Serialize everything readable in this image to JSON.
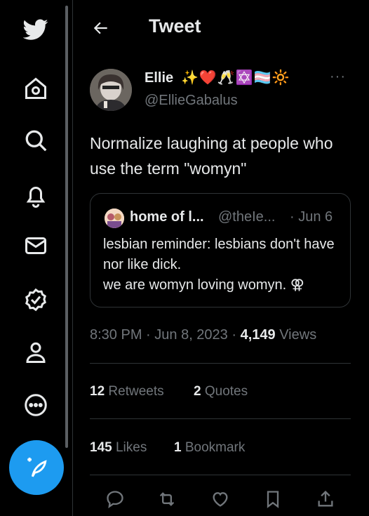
{
  "header": {
    "title": "Tweet"
  },
  "tweet": {
    "author_name": "Ellie",
    "author_emojis": "✨❤️🥂✡️🏳️‍⚧️🔆",
    "handle": "@EllieGabalus",
    "more": "···",
    "text": "Normalize laughing at people who use the term \"womyn\"",
    "time": "8:30 PM",
    "date": "Jun 8, 2023",
    "views_count": "4,149",
    "views_label": "Views"
  },
  "quote": {
    "name": "home of l...",
    "handle": "@theIe...",
    "date": "· Jun 6",
    "line1": "lesbian reminder: lesbians don't have nor like dick.",
    "line2": "we are womyn loving womyn. ⚢"
  },
  "stats": {
    "retweets_count": "12",
    "retweets_label": "Retweets",
    "quotes_count": "2",
    "quotes_label": "Quotes",
    "likes_count": "145",
    "likes_label": "Likes",
    "bookmarks_count": "1",
    "bookmarks_label": "Bookmark"
  },
  "colors": {
    "accent": "#1d9bf0",
    "background": "#000000",
    "text": "#e7e9ea",
    "muted": "#71767b",
    "border": "#2f3336"
  },
  "icons": [
    "twitter-logo-icon",
    "home-icon",
    "search-icon",
    "notifications-icon",
    "messages-icon",
    "verified-icon",
    "profile-icon",
    "more-icon",
    "compose-icon",
    "back-arrow-icon",
    "reply-icon",
    "retweet-icon",
    "like-icon",
    "bookmark-icon",
    "share-icon"
  ]
}
